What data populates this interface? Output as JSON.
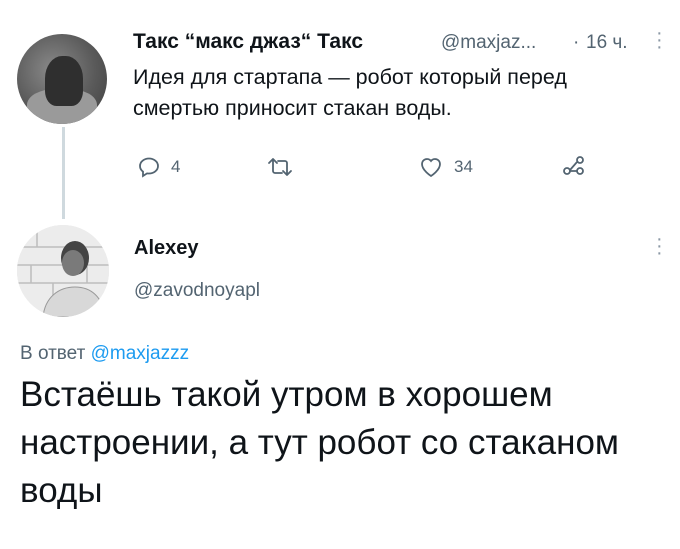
{
  "tweet1": {
    "display_name": "Такс “макс джаз“ Такс",
    "handle": "@maxjaz...",
    "separator": "·",
    "time": "16 ч.",
    "text": "Идея для стартапа — робот который перед смертью приносит стакан воды.",
    "replies": "4",
    "retweets": "",
    "likes": "34",
    "icons": [
      "reply-icon",
      "retweet-icon",
      "like-icon",
      "share-icon",
      "more-icon"
    ]
  },
  "tweet2": {
    "display_name": "Alexey",
    "handle": "@zavodnoyapl",
    "reply_prefix": "В ответ",
    "reply_handle": "@maxjazzz",
    "text": "Встаёшь такой утром в хорошем настроении, а тут робот со стаканом воды",
    "icons": [
      "more-icon"
    ]
  },
  "colors": {
    "text": "#0f1419",
    "secondary": "#536471",
    "link": "#1d9bf0",
    "thread_line": "#cfd9de"
  }
}
